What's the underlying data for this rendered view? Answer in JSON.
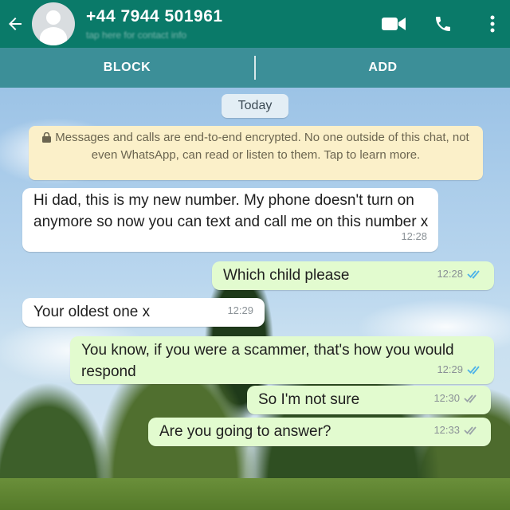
{
  "header": {
    "phone_number": "+44 7944 501961",
    "subtitle": "tap here for contact info"
  },
  "action_bar": {
    "block_label": "BLOCK",
    "add_label": "ADD"
  },
  "chat": {
    "date_chip": "Today",
    "encryption_notice": "Messages and calls are end-to-end encrypted. No one outside of this chat, not even WhatsApp, can read or listen to them. Tap to learn more.",
    "messages": [
      {
        "direction": "in",
        "text": "Hi dad, this is my new number. My phone doesn't turn on anymore so now you can text and call me on this number x",
        "time": "12:28"
      },
      {
        "direction": "out",
        "text": "Which child please",
        "time": "12:28",
        "status": "read"
      },
      {
        "direction": "in",
        "text": "Your oldest one x",
        "time": "12:29"
      },
      {
        "direction": "out",
        "text": "You know, if you were a scammer, that's how you would respond",
        "time": "12:29",
        "status": "read"
      },
      {
        "direction": "out",
        "text": "So I'm not sure",
        "time": "12:30",
        "status": "delivered"
      },
      {
        "direction": "out",
        "text": "Are you going to answer?",
        "time": "12:33",
        "status": "delivered"
      }
    ]
  },
  "colors": {
    "header": "#0a7a69",
    "action_bar": "#3c8f98",
    "outgoing_bubble": "#e2fbcf",
    "incoming_bubble": "#ffffff",
    "read_ticks": "#4fb3e8",
    "delivered_ticks": "#9aa3a8"
  },
  "icons": [
    "back-arrow-icon",
    "avatar-icon",
    "video-call-icon",
    "phone-call-icon",
    "more-options-icon",
    "lock-icon",
    "double-check-icon"
  ]
}
